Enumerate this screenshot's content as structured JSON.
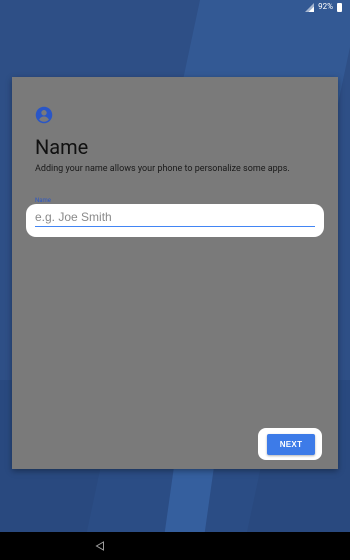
{
  "status_bar": {
    "battery_text": "92%",
    "icons": [
      "signal-icon",
      "battery-icon"
    ]
  },
  "card": {
    "icon": "account-circle-icon",
    "title": "Name",
    "subtitle": "Adding your name allows your phone to personalize some apps.",
    "field": {
      "label": "Name",
      "value": "",
      "placeholder": "e.g. Joe Smith"
    },
    "next_button_label": "NEXT"
  },
  "nav_bar": {
    "icons": [
      "back-icon"
    ]
  },
  "colors": {
    "background": "#2e4f86",
    "card": "#7a7a7a",
    "accent": "#3d7be8",
    "field_label": "#2a56c6",
    "highlight": "#ffffff"
  }
}
